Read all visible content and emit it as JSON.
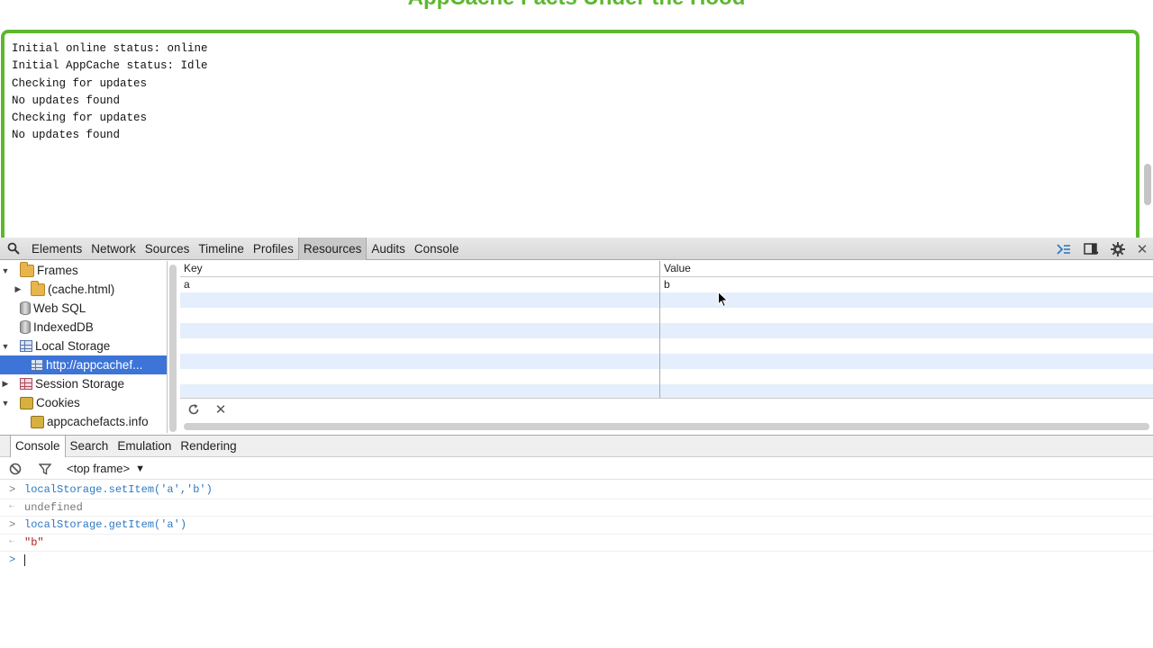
{
  "page": {
    "heading": "AppCache Facts Under the Hood",
    "log_lines": [
      "Initial online status: online",
      "Initial AppCache status: Idle",
      "Checking for updates",
      "No updates found",
      "Checking for updates",
      "No updates found"
    ]
  },
  "devtools": {
    "tabs": [
      "Elements",
      "Network",
      "Sources",
      "Timeline",
      "Profiles",
      "Resources",
      "Audits",
      "Console"
    ],
    "active_tab": "Resources",
    "sidebar": {
      "frames": "Frames",
      "frame_child": "(cache.html)",
      "web_sql": "Web SQL",
      "indexeddb": "IndexedDB",
      "local_storage": "Local Storage",
      "local_storage_child": "http://appcachef...",
      "session_storage": "Session Storage",
      "cookies": "Cookies",
      "cookies_child": "appcachefacts.info"
    },
    "grid": {
      "key_header": "Key",
      "value_header": "Value",
      "rows": [
        {
          "key": "a",
          "value": "b"
        }
      ]
    },
    "drawer_tabs": [
      "Console",
      "Search",
      "Emulation",
      "Rendering"
    ],
    "active_drawer_tab": "Console",
    "frame_selector": "<top frame>",
    "console": [
      {
        "type": "input",
        "text": "localStorage.setItem('a','b')"
      },
      {
        "type": "result",
        "text": "undefined"
      },
      {
        "type": "input",
        "text": "localStorage.getItem('a')"
      },
      {
        "type": "string",
        "text": "\"b\""
      }
    ]
  },
  "colors": {
    "accent_green": "#5cb82f",
    "selection_blue": "#3d74d8",
    "console_input_blue": "#2d79c2",
    "string_red": "#b11d1d"
  }
}
